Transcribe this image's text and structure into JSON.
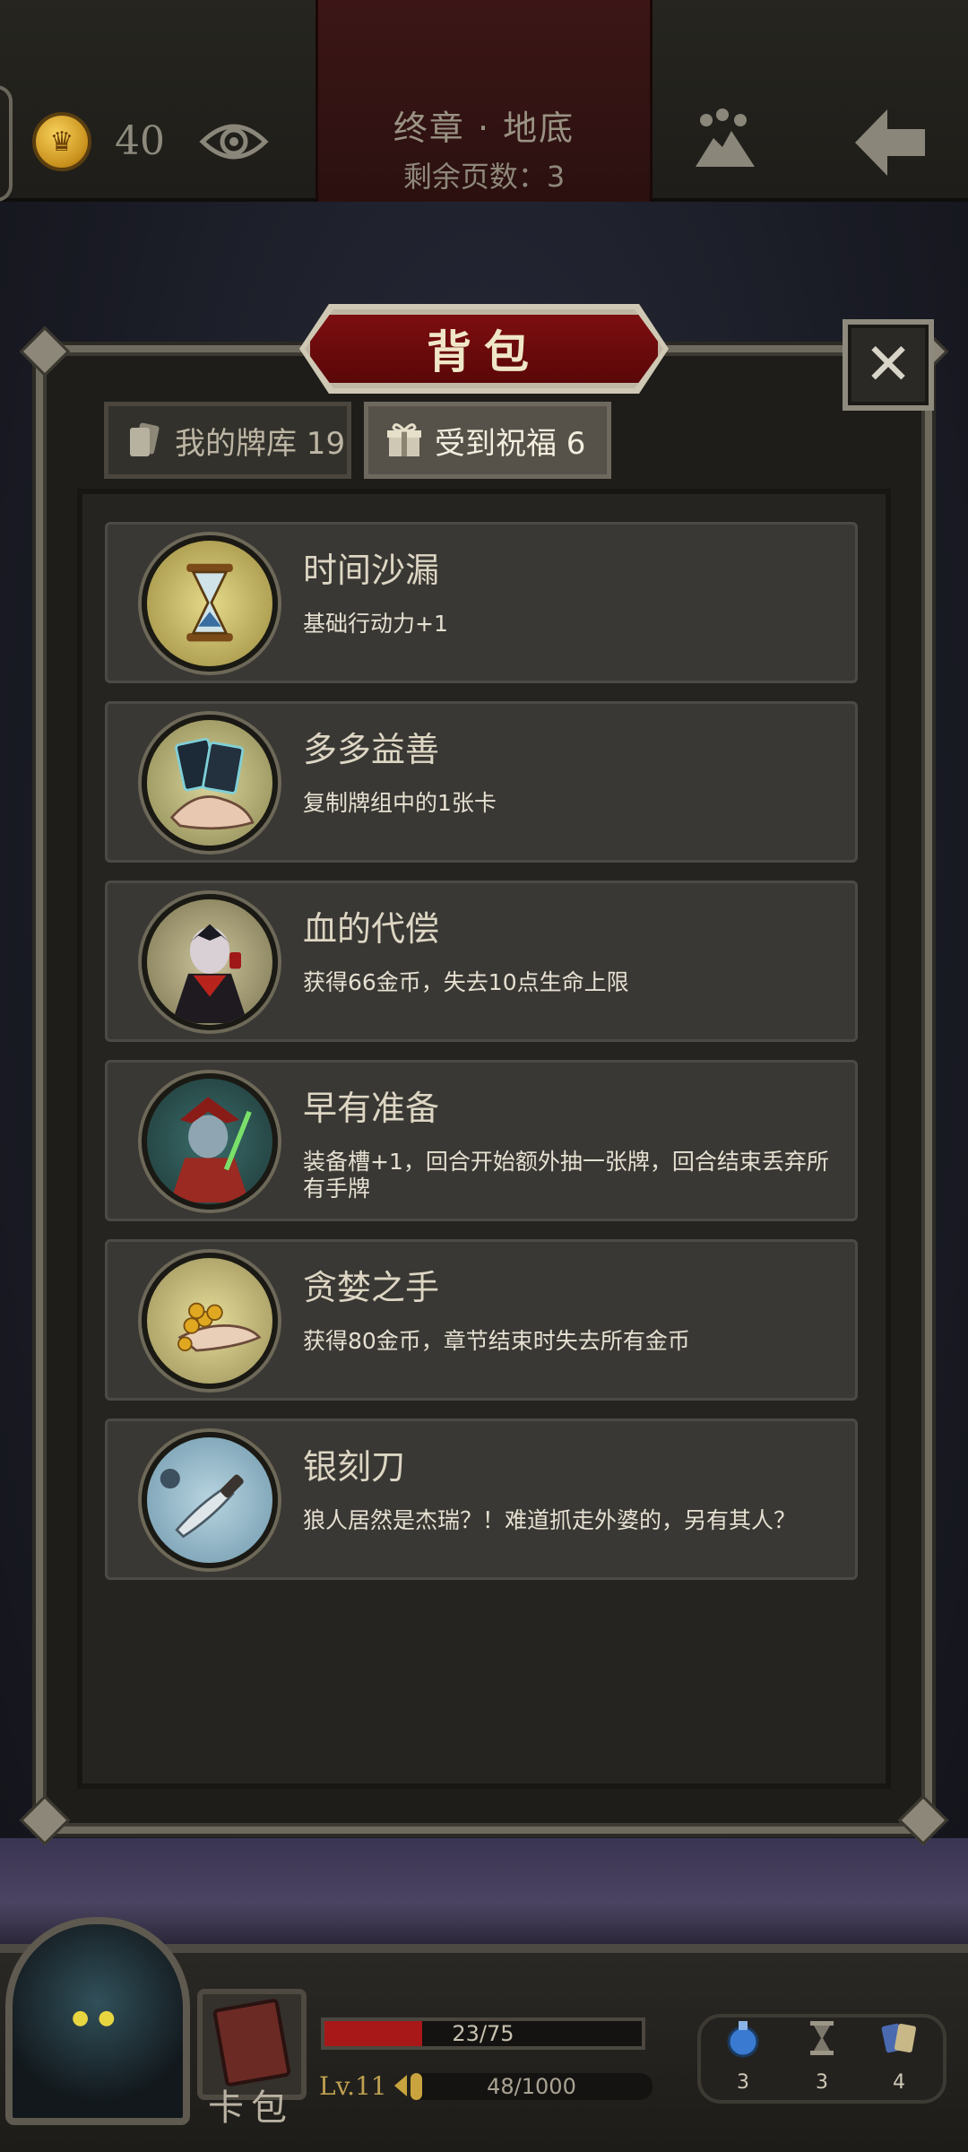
{
  "header": {
    "coins": "40",
    "chapter_title": "终章 · 地底",
    "pages_remaining": "剩余页数：3"
  },
  "panel": {
    "title": "背包",
    "tabs": [
      {
        "label": "我的牌库 19",
        "icon": "card-icon"
      },
      {
        "label": "受到祝福 6",
        "icon": "gift-icon"
      }
    ],
    "items": [
      {
        "name": "时间沙漏",
        "description": "基础行动力+1",
        "icon": "hourglass-icon"
      },
      {
        "name": "多多益善",
        "description": "复制牌组中的1张卡",
        "icon": "cards-hand-icon"
      },
      {
        "name": "血的代偿",
        "description": "获得66金币，失去10点生命上限",
        "icon": "vampire-icon"
      },
      {
        "name": "早有准备",
        "description": "装备槽+1，回合开始额外抽一张牌，回合结束丢弃所有手牌",
        "icon": "hunter-icon"
      },
      {
        "name": "贪婪之手",
        "description": "获得80金币，章节结束时失去所有金币",
        "icon": "gold-hand-icon"
      },
      {
        "name": "银刻刀",
        "description": "狼人居然是杰瑞？！难道抓走外婆的，另有其人？",
        "icon": "silver-knife-icon"
      }
    ]
  },
  "hud": {
    "card_pack_label": "卡包",
    "hp_text": "23/75",
    "hp_fraction": 0.307,
    "level": "Lv.11",
    "xp_text": "48/1000",
    "xp_fraction": 0.048,
    "resources": [
      {
        "icon": "potion-icon",
        "count": "3"
      },
      {
        "icon": "hourglass-small-icon",
        "count": "3"
      },
      {
        "icon": "cards-icon",
        "count": "4"
      }
    ]
  },
  "colors": {
    "hp": "#a81818",
    "xp": "#c9a43e",
    "title_plate": "#7d0e10"
  }
}
